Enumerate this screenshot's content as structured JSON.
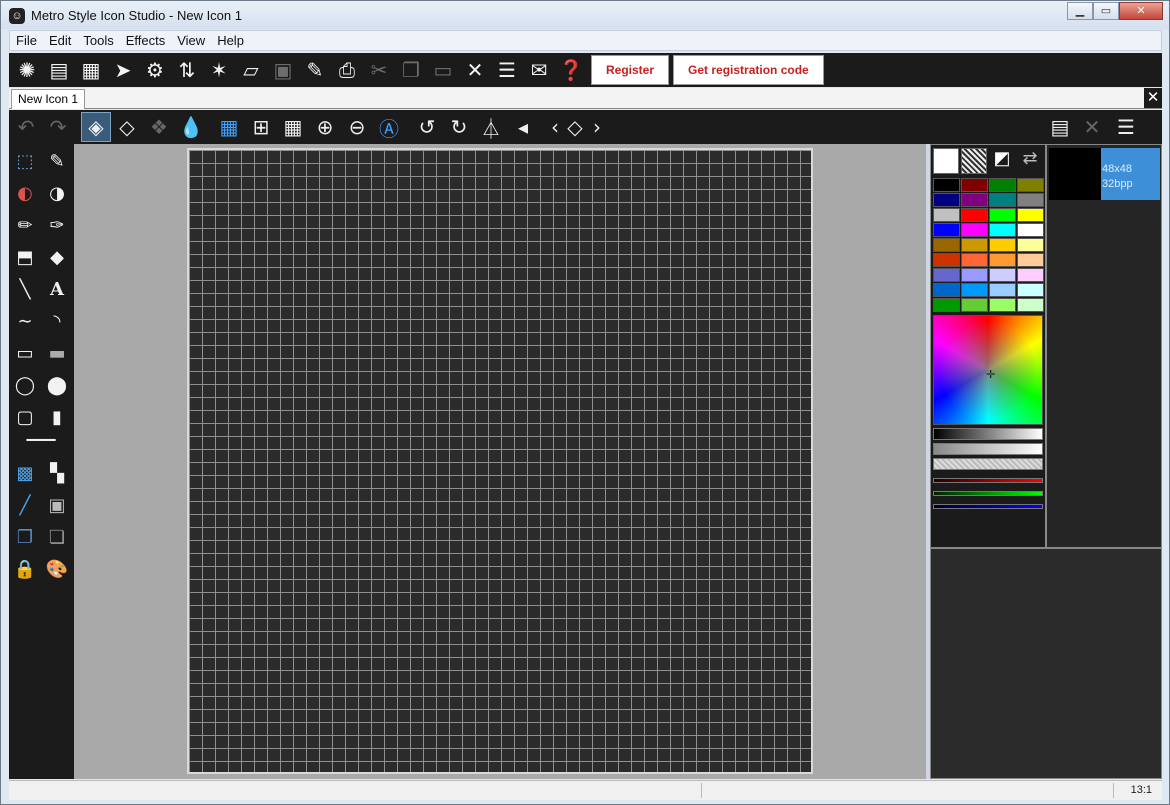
{
  "window": {
    "title": "Metro Style Icon Studio - New Icon 1"
  },
  "menu": [
    "File",
    "Edit",
    "Tools",
    "Effects",
    "View",
    "Help"
  ],
  "toolbar": {
    "icons": [
      "new-icon",
      "new-icon-from-image",
      "new-library",
      "select",
      "settings",
      "import",
      "wizard",
      "open",
      "save",
      "save-as",
      "print",
      "cut",
      "copy",
      "paste",
      "delete",
      "properties",
      "export",
      "help"
    ],
    "register_label": "Register",
    "get_code_label": "Get registration code"
  },
  "tabs": [
    {
      "label": "New Icon 1"
    }
  ],
  "toolbar2": {
    "icons": [
      "undo",
      "redo",
      "view-3d-dark",
      "view-3d-light",
      "view-3d-multi",
      "transparency",
      "grid-fine",
      "grid-medium",
      "grid-large",
      "zoom-in",
      "zoom-out",
      "zoom-actual",
      "rotate-left",
      "rotate-right",
      "flip-horizontal",
      "flip-vertical",
      "shift-left",
      "shift-all",
      "shift-right",
      "image-format",
      "delete-format",
      "layers"
    ]
  },
  "tools": [
    "marquee",
    "eyedropper",
    "eraser-color",
    "eraser",
    "pencil",
    "brush",
    "fill-bucket",
    "replace-color",
    "line",
    "text",
    "curve",
    "arc",
    "rectangle",
    "filled-rectangle",
    "ellipse",
    "filled-ellipse",
    "rounded-rectangle",
    "filled-rounded-rectangle",
    "line-width",
    "gradient",
    "checker",
    "dodge",
    "blur",
    "clone",
    "layers-merge",
    "lock-alpha",
    "lock-palette"
  ],
  "palette": {
    "colors": [
      "#000000",
      "#800000",
      "#008000",
      "#808000",
      "#000080",
      "#800080",
      "#008080",
      "#808080",
      "#c0c0c0",
      "#ff0000",
      "#00ff00",
      "#ffff00",
      "#0000ff",
      "#ff00ff",
      "#00ffff",
      "#ffffff",
      "#996600",
      "#cc9900",
      "#ffcc00",
      "#ffff99",
      "#cc3300",
      "#ff6633",
      "#ff9933",
      "#ffcc99",
      "#6666cc",
      "#9999ff",
      "#ccccff",
      "#ffccff",
      "#0066cc",
      "#0099ff",
      "#99ccff",
      "#ccffff",
      "#009900",
      "#66cc33",
      "#99ff66",
      "#ccffcc"
    ],
    "foreground": "#ffffff",
    "background": "transparent"
  },
  "image_formats": [
    {
      "size": "48x48",
      "depth": "32bpp"
    }
  ],
  "status": {
    "zoom": "13:1"
  }
}
